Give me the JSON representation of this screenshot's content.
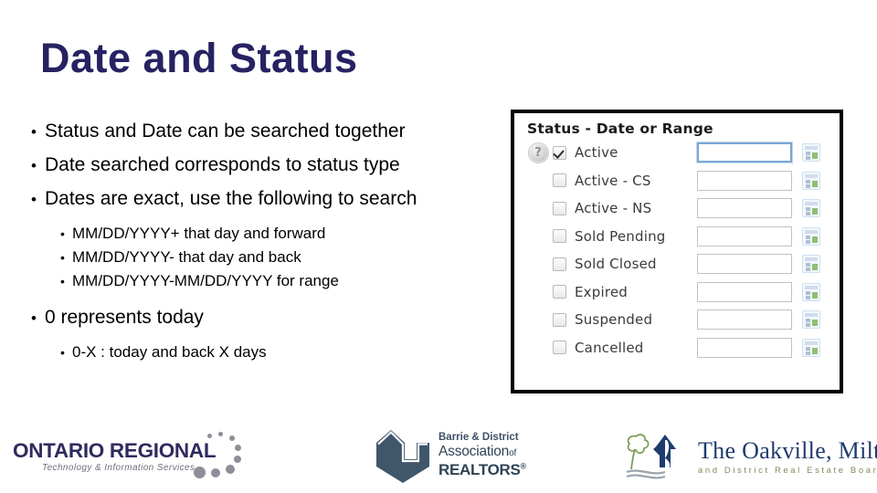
{
  "slide": {
    "title": "Date and Status",
    "title_color": "#272262",
    "bullets": [
      {
        "level": 1,
        "text": "Status and Date can be searched together"
      },
      {
        "level": 1,
        "text": "Date searched corresponds to status type"
      },
      {
        "level": 1,
        "text": "Dates are exact, use the following to search"
      },
      {
        "level": 2,
        "text": "MM/DD/YYYY+ that day and forward"
      },
      {
        "level": 2,
        "text": "MM/DD/YYYY- that day and back"
      },
      {
        "level": 2,
        "text": "MM/DD/YYYY-MM/DD/YYYY for range"
      },
      {
        "level": 1,
        "text": "0 represents today"
      },
      {
        "level": 2,
        "text": "0-X : today and back X days"
      }
    ],
    "bullet_glyph": "•"
  },
  "screenshot": {
    "panel_title": "Status - Date or Range",
    "help_icon_glyph": "?",
    "rows": [
      {
        "label": "Active",
        "checked": true,
        "date_value": "",
        "focused": true,
        "has_help": true
      },
      {
        "label": "Active - CS",
        "checked": false,
        "date_value": "",
        "focused": false,
        "has_help": false
      },
      {
        "label": "Active - NS",
        "checked": false,
        "date_value": "",
        "focused": false,
        "has_help": false
      },
      {
        "label": "Sold Pending",
        "checked": false,
        "date_value": "",
        "focused": false,
        "has_help": false
      },
      {
        "label": "Sold Closed",
        "checked": false,
        "date_value": "",
        "focused": false,
        "has_help": false
      },
      {
        "label": "Expired",
        "checked": false,
        "date_value": "",
        "focused": false,
        "has_help": false
      },
      {
        "label": "Suspended",
        "checked": false,
        "date_value": "",
        "focused": false,
        "has_help": false
      },
      {
        "label": "Cancelled",
        "checked": false,
        "date_value": "",
        "focused": false,
        "has_help": false
      }
    ],
    "pending_row": {
      "label": "Sold Pending"
    },
    "focus_border_color": "#7aa7d4",
    "calendar_button_icon": "calendar-picker-icon"
  },
  "footer": {
    "ontario": {
      "name": "ONTARIO REGIONAL",
      "tagline": "Technology & Information Services",
      "color": "#2f2a5e",
      "dot_color": "#8e8e98"
    },
    "barrie": {
      "line1": "Barrie & District",
      "line2": "Association",
      "line2_small": "of",
      "line3": "REALTORS",
      "registered_mark": "®",
      "color": "#2f4356"
    },
    "oakville": {
      "line1": "The Oakville, Milton",
      "line2": "and District Real Estate Board",
      "color": "#1f3b6e",
      "accent_color": "#7d8c5a"
    }
  }
}
